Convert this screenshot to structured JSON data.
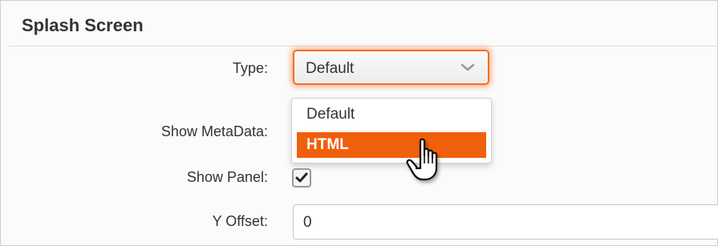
{
  "panel": {
    "title": "Splash Screen"
  },
  "fields": {
    "type_label": "Type:",
    "type_value": "Default",
    "type_options": [
      "Default",
      "HTML"
    ],
    "type_highlighted": "HTML",
    "show_metadata_label": "Show MetaData:",
    "show_panel_label": "Show Panel:",
    "show_panel_checked": true,
    "y_offset_label": "Y Offset:",
    "y_offset_value": "0"
  },
  "colors": {
    "accent": "#f36f21",
    "highlight": "#f05f0c"
  },
  "icons": {
    "select_arrow": "chevron-down-icon",
    "checkbox_mark": "checkmark-icon",
    "cursor": "hand-pointer-icon"
  }
}
